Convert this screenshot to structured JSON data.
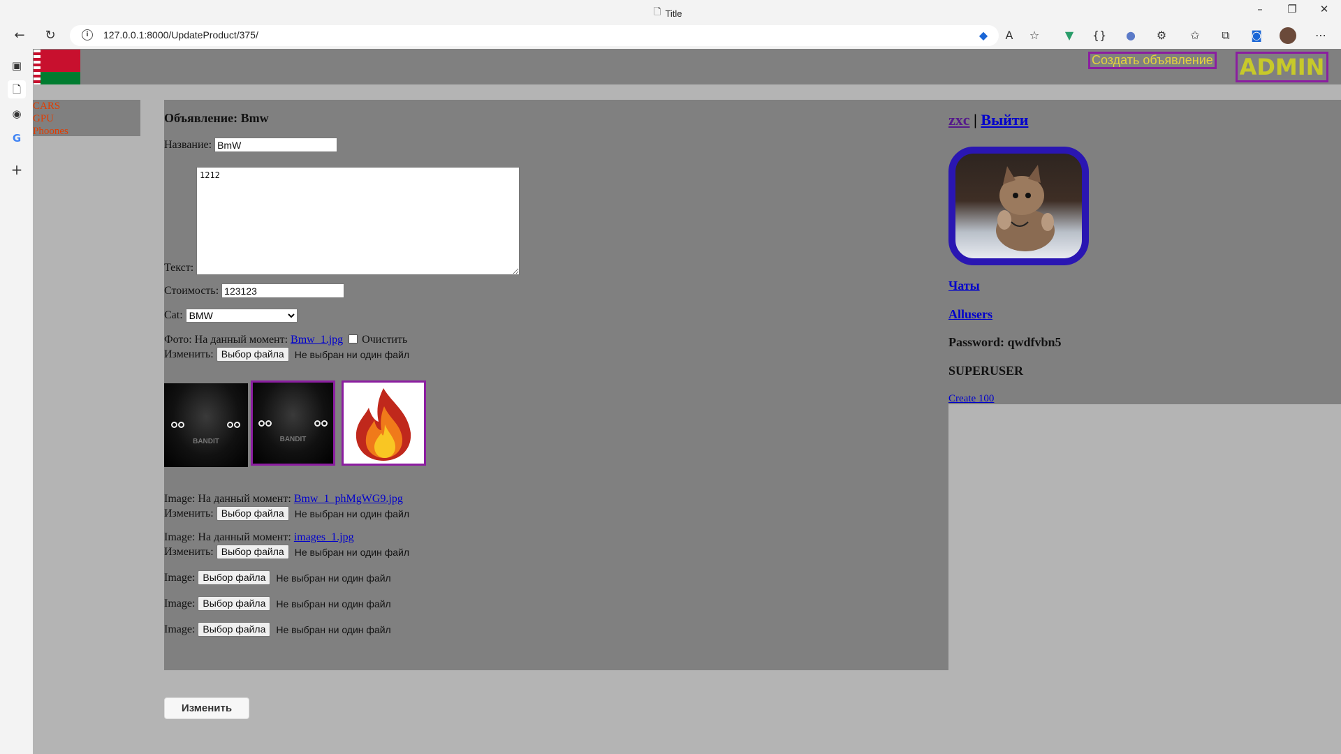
{
  "browser": {
    "tab_title": "Title",
    "url": "127.0.0.1:8000/UpdateProduct/375/"
  },
  "header": {
    "create_ad": "Создать объявление",
    "admin": "ADMIN"
  },
  "categories": [
    "CARS",
    "GPU",
    "Phoones"
  ],
  "form": {
    "heading": "Объявление: Bmw",
    "name_label": "Название:",
    "name_value": "BmW",
    "text_label": "Текст:",
    "text_value": "1212",
    "price_label": "Стоимость:",
    "price_value": "123123",
    "cat_label": "Cat:",
    "cat_value": "BMW",
    "photo_label": "Фото: На данный момент:",
    "photo_file": "Bmw_1.jpg",
    "clear_label": "Очистить",
    "change_label": "Изменить:",
    "file_button": "Выбор файла",
    "no_file": "Не выбран ни один файл",
    "image_label": "Image:",
    "image1_label": "Image: На данный момент:",
    "image1_file": "Bmw_1_phMgWG9.jpg",
    "image2_label": "Image: На данный момент:",
    "image2_file": "images_1.jpg",
    "submit": "Изменить",
    "thumb_text": "BANDIT"
  },
  "user": {
    "name": "zxc",
    "separator": "|",
    "logout": "Выйти",
    "chats": "Чаты",
    "allusers": "Allusers",
    "password": "Password: qwdfvbn5",
    "role": "SUPERUSER",
    "create100": "Create 100"
  }
}
